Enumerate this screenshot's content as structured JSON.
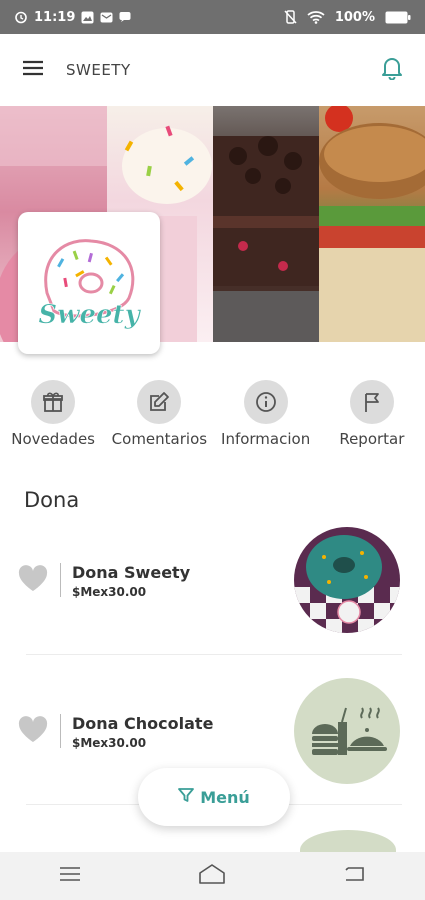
{
  "status_bar": {
    "time": "11:19",
    "battery": "100%"
  },
  "app_bar": {
    "title": "SWEETY"
  },
  "logo": {
    "text": "Sweety"
  },
  "actions": [
    {
      "label": "Novedades",
      "icon": "gift-icon"
    },
    {
      "label": "Comentarios",
      "icon": "edit-icon"
    },
    {
      "label": "Informacion",
      "icon": "info-icon"
    },
    {
      "label": "Reportar",
      "icon": "flag-icon"
    }
  ],
  "section": {
    "title": "Dona"
  },
  "items": [
    {
      "name": "Dona Sweety",
      "price": "$Mex30.00",
      "image": "donut-photo"
    },
    {
      "name": "Dona Chocolate",
      "price": "$Mex30.00",
      "image": "food-placeholder-icon"
    }
  ],
  "menu_button": {
    "label": "Menú"
  },
  "colors": {
    "accent": "#3a9e97",
    "status_bar": "#6f6f6f",
    "placeholder": "#d3dcc6"
  }
}
